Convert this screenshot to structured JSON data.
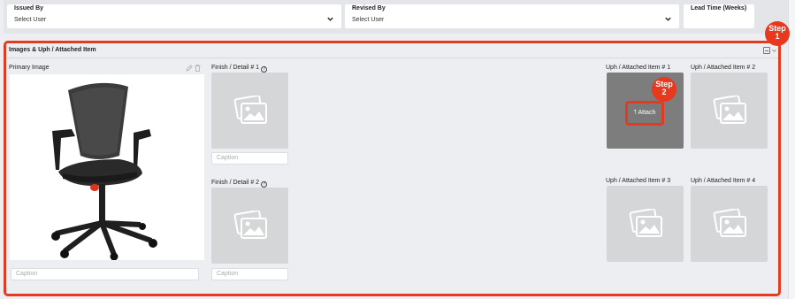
{
  "top_fields": {
    "issued_by": {
      "label": "Issued By",
      "value": "Select User"
    },
    "revised_by": {
      "label": "Revised By",
      "value": "Select User"
    },
    "lead_time": {
      "label": "Lead Time (Weeks)",
      "value": ""
    }
  },
  "section": {
    "title": "Images & Uph / Attached Item",
    "primary_image_label": "Primary Image",
    "primary_caption_placeholder": "Caption",
    "finish_1_label": "Finish / Detail # 1",
    "finish_1_caption": "Caption",
    "finish_2_label": "Finish / Detail # 2",
    "finish_2_caption": "Caption",
    "help_glyph": "?",
    "uph_1_label": "Uph / Attached Item # 1",
    "uph_2_label": "Uph / Attached Item # 2",
    "uph_3_label": "Uph / Attached Item # 3",
    "uph_4_label": "Uph / Attached Item # 4",
    "attach_label": "Attach",
    "attach_glyph": "⭡"
  },
  "annotations": {
    "step1": {
      "word": "Step",
      "num": "1"
    },
    "step2": {
      "word": "Step",
      "num": "2"
    }
  },
  "colors": {
    "annotation_red": "#e33b22",
    "placeholder_gray": "#d5d6d8",
    "hover_gray": "#7d7d7d"
  },
  "icons": [
    "chevron-down-icon",
    "pencil-icon",
    "trash-icon",
    "help-icon",
    "image-placeholder-icon",
    "upload-icon",
    "collapse-icon",
    "caret-icon"
  ]
}
